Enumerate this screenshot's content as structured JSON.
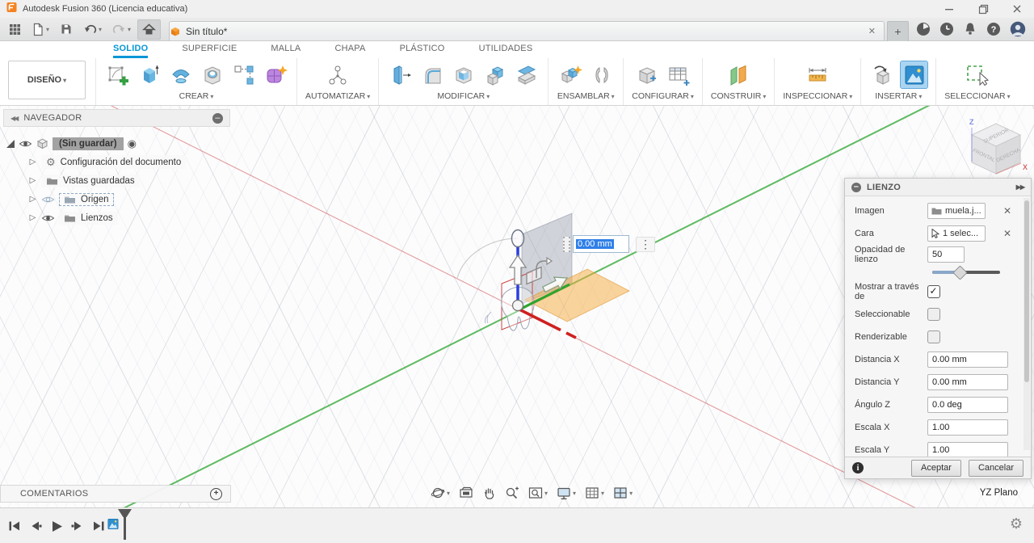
{
  "titlebar": {
    "title": "Autodesk Fusion 360 (Licencia educativa)"
  },
  "appbar": {
    "document_tab": "Sin título*"
  },
  "ribbon_tabs": {
    "tabs": [
      {
        "label": "SOLIDO",
        "active": true
      },
      {
        "label": "SUPERFICIE"
      },
      {
        "label": "MALLA"
      },
      {
        "label": "CHAPA"
      },
      {
        "label": "PLÁSTICO"
      },
      {
        "label": "UTILIDADES"
      }
    ]
  },
  "ribbon": {
    "design_label": "DISEÑO",
    "groups": {
      "crear": "CREAR",
      "automatizar": "AUTOMATIZAR",
      "modificar": "MODIFICAR",
      "ensamblar": "ENSAMBLAR",
      "configurar": "CONFIGURAR",
      "construir": "CONSTRUIR",
      "inspeccionar": "INSPECCIONAR",
      "insertar": "INSERTAR",
      "seleccionar": "SELECCIONAR"
    }
  },
  "navigator": {
    "title": "NAVEGADOR",
    "root_label": "(Sin guardar)",
    "doc_settings": "Configuración del documento",
    "saved_views": "Vistas guardadas",
    "origin": "Origen",
    "canvases": "Lienzos"
  },
  "lienzo_dialog": {
    "title": "LIENZO",
    "imagen_label": "Imagen",
    "imagen_value": "muela.j...",
    "cara_label": "Cara",
    "cara_value": "1 selec...",
    "opacidad_label": "Opacidad de lienzo",
    "opacidad_value": "50",
    "opacidad_slider_percent": 40,
    "mostrar_label": "Mostrar a través de",
    "mostrar_checked": true,
    "seleccionable_label": "Seleccionable",
    "seleccionable_checked": false,
    "renderizable_label": "Renderizable",
    "renderizable_checked": false,
    "distancia_x_label": "Distancia X",
    "distancia_x_value": "0.00 mm",
    "distancia_y_label": "Distancia Y",
    "distancia_y_value": "0.00 mm",
    "angulo_z_label": "Ángulo Z",
    "angulo_z_value": "0.0 deg",
    "escala_x_label": "Escala X",
    "escala_x_value": "1.00",
    "escala_y_label": "Escala Y",
    "escala_y_value": "1.00",
    "aceptar_label": "Aceptar",
    "cancelar_label": "Cancelar"
  },
  "viewport": {
    "dim_input": "0.00 mm",
    "plane_label": "YZ Plano",
    "viewcube": {
      "top": "SUPERIOR",
      "front": "FRONTAL",
      "right": "DERECHA",
      "z_axis": "Z",
      "x_axis": "X"
    }
  },
  "comments": {
    "title": "COMENTARIOS"
  },
  "icons": {
    "close": "✕",
    "plus": "+",
    "caret_down": "▾",
    "collapse_left": "◀◀",
    "minus": "–",
    "expand_right": "▶▶",
    "radio_target": "◉",
    "gear": "⚙",
    "kebab": "⋮",
    "info": "i",
    "question": "?",
    "expander": "▷",
    "add": "+"
  },
  "colors": {
    "accent_blue": "#0696d7",
    "axis_red": "#cc2a2a",
    "axis_green": "#3aa43a",
    "axis_blue": "#2a3fe0",
    "canvas_orange": "#f5a93c"
  }
}
